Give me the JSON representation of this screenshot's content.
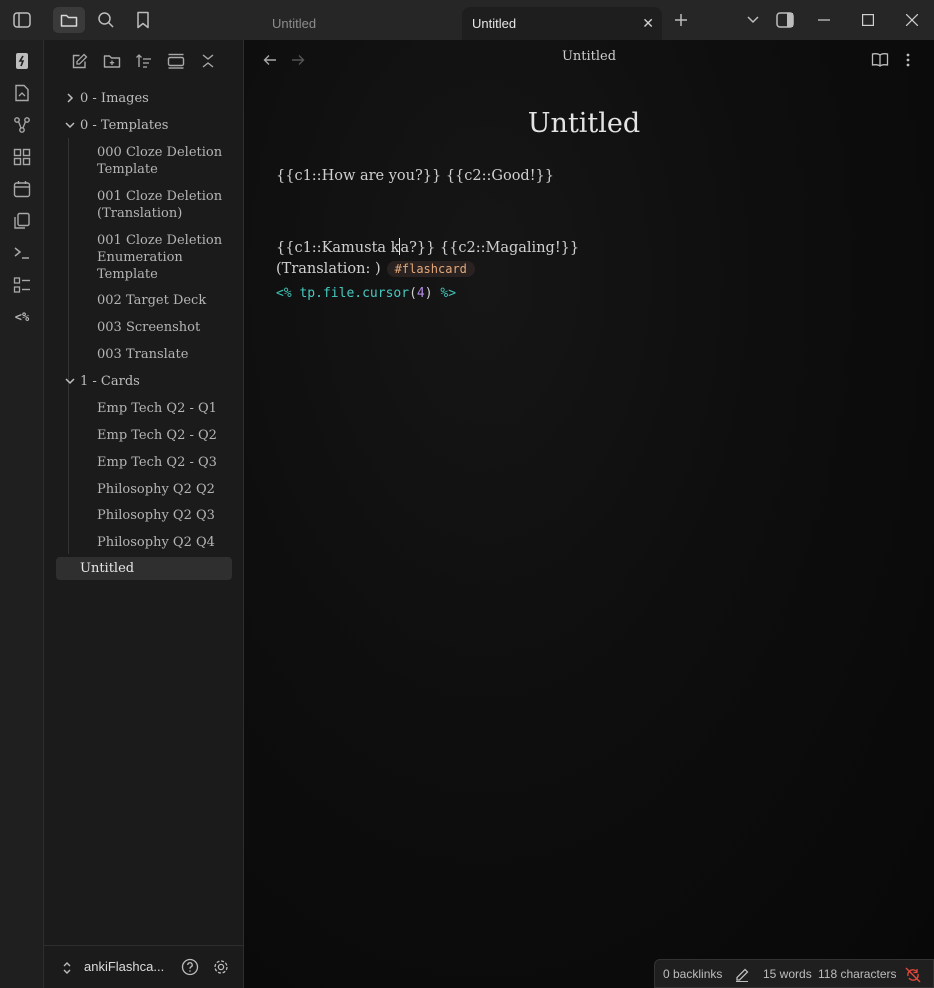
{
  "titlebar": {
    "tabs": [
      {
        "label": "Untitled",
        "active": false
      },
      {
        "label": "Untitled",
        "active": true
      }
    ],
    "close_glyph": "✕",
    "icons": [
      "sidebar-toggle-icon",
      "folder-icon",
      "search-icon",
      "bookmark-icon",
      "plus-icon",
      "chevron-down-icon",
      "right-sidebar-icon",
      "minimize-icon",
      "maximize-icon",
      "window-close-icon"
    ]
  },
  "ribbon": {
    "icons": [
      "flashcards-icon",
      "open-file-icon",
      "graph-icon",
      "canvas-icon",
      "calendar-icon",
      "copy-icon",
      "terminal-icon",
      "checklist-icon",
      "templater-icon"
    ],
    "templater_glyph": "<%"
  },
  "sidebar": {
    "tools": [
      "new-note-icon",
      "new-folder-icon",
      "sort-icon",
      "collapse-icon",
      "close-all-icon"
    ],
    "folders": [
      {
        "label": "0 - Images",
        "expanded": false
      },
      {
        "label": "0 - Templates",
        "expanded": true
      },
      {
        "label": "1 - Cards",
        "expanded": true
      }
    ],
    "template_files": [
      {
        "line1": "000 Cloze Deletion",
        "line2": "Template",
        "line3": ""
      },
      {
        "line1": "001 Cloze Deletion",
        "line2": "(Translation)",
        "line3": ""
      },
      {
        "line1": "001 Cloze Deletion",
        "line2": "Enumeration",
        "line3": "Template"
      },
      {
        "line1": "002 Target Deck",
        "line2": "",
        "line3": ""
      },
      {
        "line1": "003 Screenshot",
        "line2": "",
        "line3": ""
      },
      {
        "line1": "003 Translate",
        "line2": "",
        "line3": ""
      }
    ],
    "card_files": [
      "Emp Tech Q2 - Q1",
      "Emp Tech Q2 - Q2",
      "Emp Tech Q2 - Q3",
      "Philosophy Q2 Q2",
      "Philosophy Q2 Q3",
      "Philosophy Q2 Q4"
    ],
    "selected_file": "Untitled",
    "vault_name": "ankiFlashca..."
  },
  "main": {
    "view_title": "Untitled",
    "note_title": "Untitled",
    "line1": "{{c1::How are you?}} {{c2::Good!}}",
    "line2_before_cursor": "{{c1::Kamusta k",
    "line2_after_cursor": "a?}} {{c2::Magaling!}}",
    "line3_text": "(Translation: )",
    "tag": "#flashcard",
    "code_open": "<%",
    "code_fn": "tp.file.cursor",
    "code_lparen": "(",
    "code_arg": "4",
    "code_rparen": ")",
    "code_close": "%>"
  },
  "status": {
    "backlinks": "0 backlinks",
    "words": "15 words",
    "characters": "118 characters"
  },
  "colors": {
    "accent_tag": "#e3a87a",
    "code_teal": "#3fc2b6",
    "code_number": "#b38ae6",
    "sync_error": "#e0483c"
  }
}
